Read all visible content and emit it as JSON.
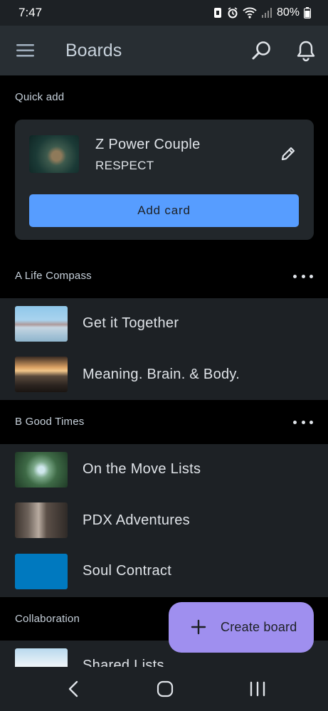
{
  "status_bar": {
    "time": "7:47",
    "battery": "80%"
  },
  "app_bar": {
    "title": "Boards"
  },
  "quick_add": {
    "section_label": "Quick add",
    "board_name": "Z Power Couple",
    "list_name": "RESPECT",
    "button_label": "Add card"
  },
  "workspaces": [
    {
      "name": "A Life Compass",
      "boards": [
        {
          "name": "Get it Together"
        },
        {
          "name": "Meaning. Brain. & Body."
        }
      ]
    },
    {
      "name": "B Good Times",
      "boards": [
        {
          "name": "On the Move Lists"
        },
        {
          "name": "PDX Adventures"
        },
        {
          "name": "Soul Contract"
        }
      ]
    },
    {
      "name": "Collaboration",
      "boards": [
        {
          "name": "Shared Lists"
        }
      ]
    }
  ],
  "fab": {
    "label": "Create board"
  },
  "colors": {
    "accent_blue": "#579dff",
    "fab_purple": "#9f8fef",
    "surface": "#1d2125",
    "card": "#22272b",
    "app_bar": "#282e33",
    "soul_contract_board": "#0079bf"
  }
}
